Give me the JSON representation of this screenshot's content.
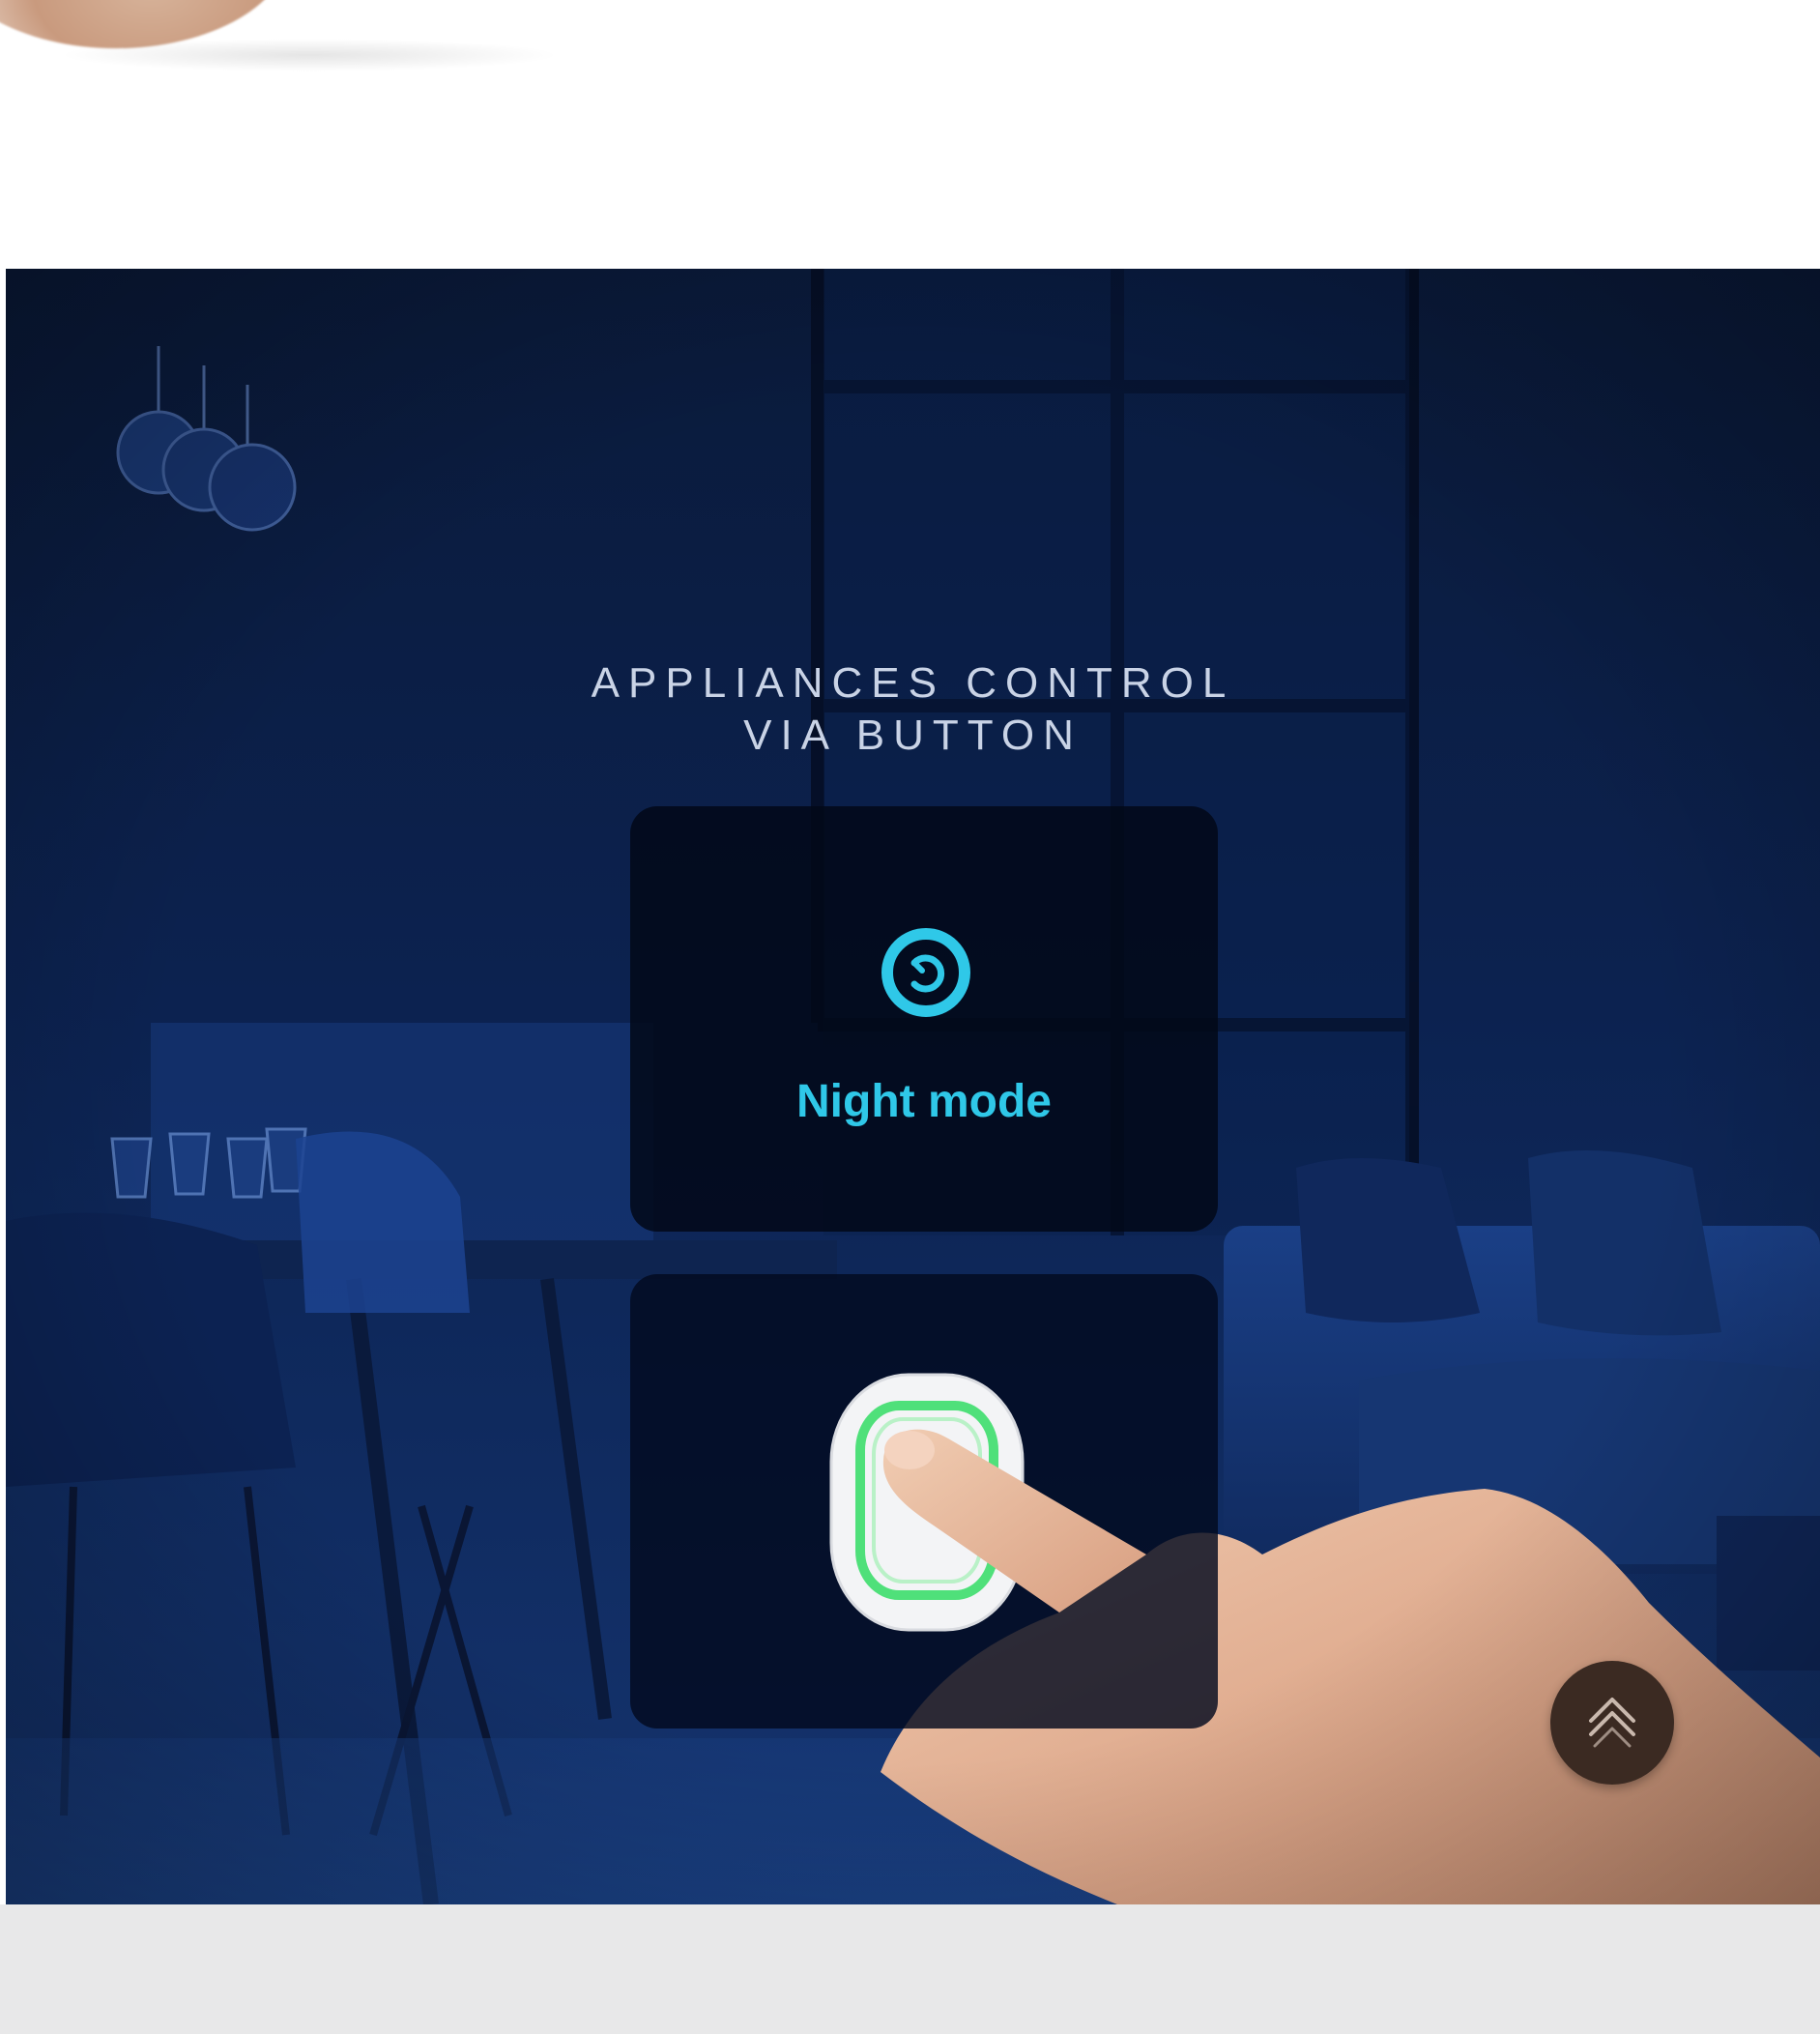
{
  "hero": {
    "title_line1": "APPLIANCES CONTROL",
    "title_line2": "VIA BUTTON",
    "mode_icon": "night-mode-icon",
    "mode_label": "Night mode",
    "device_icon": "smart-button-device"
  },
  "scroll_top": {
    "icon": "double-chevron-up-icon"
  },
  "colors": {
    "hero_bg": "#0c2250",
    "accent_cyan": "#2fc8e8",
    "device_led": "#4fe07a",
    "scroll_button": "#3b2a22",
    "footer_band": "#e8e8e9"
  }
}
